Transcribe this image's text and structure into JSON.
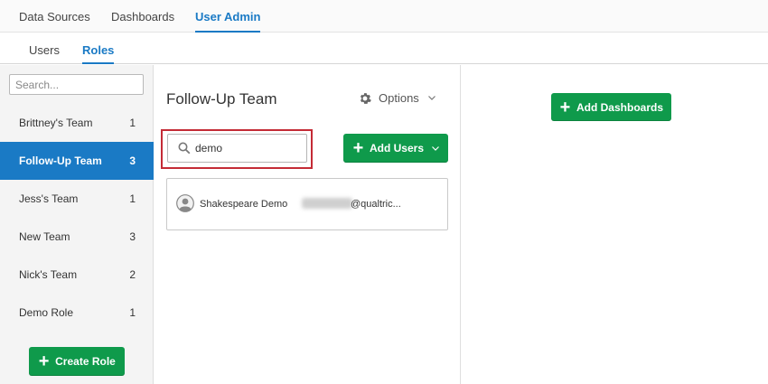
{
  "top_nav": {
    "tabs": [
      {
        "label": "Data Sources"
      },
      {
        "label": "Dashboards"
      },
      {
        "label": "User Admin"
      }
    ]
  },
  "sub_nav": {
    "tabs": [
      {
        "label": "Users"
      },
      {
        "label": "Roles"
      }
    ]
  },
  "sidebar": {
    "search_placeholder": "Search...",
    "roles": [
      {
        "name": "Brittney's Team",
        "count": "1"
      },
      {
        "name": "Follow-Up Team",
        "count": "3"
      },
      {
        "name": "Jess's Team",
        "count": "1"
      },
      {
        "name": "New Team",
        "count": "3"
      },
      {
        "name": "Nick's Team",
        "count": "2"
      },
      {
        "name": "Demo Role",
        "count": "1"
      }
    ],
    "active_role_index": 1,
    "create_role_label": "Create Role"
  },
  "main": {
    "title": "Follow-Up Team",
    "options_label": "Options",
    "member_search_value": "demo",
    "add_users_label": "Add Users",
    "members": [
      {
        "name": "Shakespeare Demo",
        "email_visible": "@qualtric..."
      }
    ]
  },
  "right": {
    "add_dashboards_label": "Add Dashboards"
  },
  "colors": {
    "accent_blue": "#1a7ac5",
    "button_green": "#0f9a4b",
    "highlight_red": "#c42b36"
  },
  "icons": [
    "gear-icon",
    "chevron-down-icon",
    "magnifier-icon",
    "plus-icon",
    "avatar-icon"
  ]
}
